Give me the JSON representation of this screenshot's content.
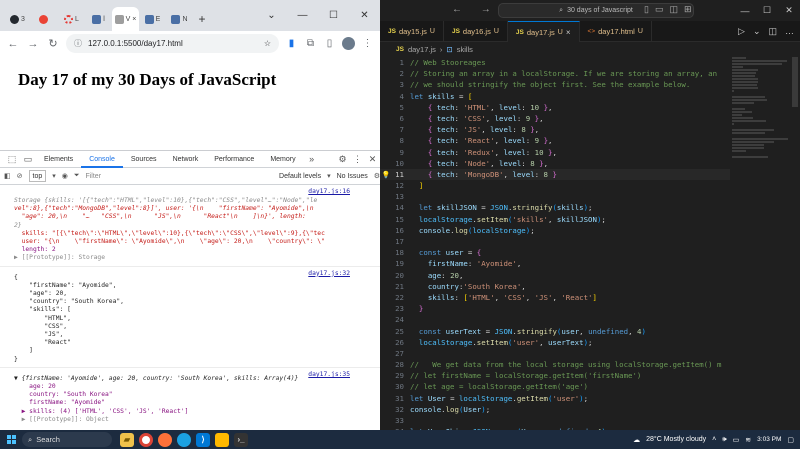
{
  "browser": {
    "tabs": [
      {
        "icon": "github-icon",
        "label": "3"
      },
      {
        "icon": "gmail-icon",
        "label": ""
      },
      {
        "icon": "tab-icon",
        "label": "L"
      },
      {
        "icon": "tab-icon",
        "label": "l"
      },
      {
        "icon": "tab-icon",
        "label": "V"
      },
      {
        "icon": "tab-icon",
        "label": "E"
      },
      {
        "icon": "tab-icon",
        "label": "N"
      }
    ],
    "url": "127.0.0.1:5500/day17.html",
    "page_heading": "Day 17 of my 30 Days of JavaScript"
  },
  "devtools": {
    "tabs": [
      "Elements",
      "Console",
      "Sources",
      "Network",
      "Performance",
      "Memory"
    ],
    "active_tab": "Console",
    "context": "top",
    "filter_placeholder": "Filter",
    "levels": "Default levels",
    "issues": "No Issues",
    "messages": [
      {
        "source": "day17.js:16",
        "lines": [
          "Storage {skills: '[{\"tech\":\"HTML\",\"level\":10},{\"tech\":\"CSS\",\"level\"…\":\"Node\",\"le",
          "vel\":8},{\"tech\":\"MongoDB\",\"level\":8}]', user: '{\\n    \"firstName\": \"Ayomide\",\\n",
          "  \"age\": 20,\\n    \"…   \"CSS\",\\n      \"JS\",\\n      \"React\"\\n    ]\\n}', length:",
          "2}",
          "  skills: \"[{\\\"tech\\\":\\\"HTML\\\",\\\"level\\\":10},{\\\"tech\\\":\\\"CSS\\\",\\\"level\\\":9},{\\\"tec",
          "  user: \"{\\n    \\\"firstName\\\": \\\"Ayomide\\\",\\n    \\\"age\\\": 20,\\n    \\\"country\\\": \\\"",
          "  length: 2",
          "▶ [[Prototype]]: Storage"
        ]
      },
      {
        "source": "day17.js:32",
        "lines": [
          "{",
          "    \"firstName\": \"Ayomide\",",
          "    \"age\": 20,",
          "    \"country\": \"South Korea\",",
          "    \"skills\": [",
          "        \"HTML\",",
          "        \"CSS\",",
          "        \"JS\",",
          "        \"React\"",
          "    ]",
          "}"
        ]
      },
      {
        "source": "day17.js:35",
        "lines": [
          "▼ {firstName: 'Ayomide', age: 20, country: 'South Korea', skills: Array(4)}",
          "    age: 20",
          "    country: \"South Korea\"",
          "    firstName: \"Ayomide\"",
          "  ▶ skills: (4) ['HTML', 'CSS', 'JS', 'React']",
          "  ▶ [[Prototype]]: Object"
        ]
      }
    ]
  },
  "vscode": {
    "search": "30 days of Javascript",
    "tabs": [
      {
        "name": "day15.js",
        "kind": "JS",
        "status": "U",
        "active": false
      },
      {
        "name": "day16.js",
        "kind": "JS",
        "status": "U",
        "active": false
      },
      {
        "name": "day17.js",
        "kind": "JS",
        "status": "U",
        "active": true
      },
      {
        "name": "day17.html",
        "kind": "<>",
        "status": "U",
        "active": false
      }
    ],
    "breadcrumb": {
      "file": "day17.js",
      "symbol": "skills"
    },
    "current_line": 11,
    "code": [
      "// Web Stooreages",
      "// Storing an array in a localStorage. If we are storing an array, an",
      "// we should stringify the object first. See the example below.",
      "let skills = [",
      "    { tech: 'HTML', level: 10 },",
      "    { tech: 'CSS', level: 9 },",
      "    { tech: 'JS', level: 8 },",
      "    { tech: 'React', level: 9 },",
      "    { tech: 'Redux', level: 10 },",
      "    { tech: 'Node', level: 8 },",
      "    { tech: 'MongoDB', level: 8 }",
      "  ]",
      "",
      "  let skillJSON = JSON.stringify(skills);",
      "  localStorage.setItem('skills', skillJSON);",
      "  console.log(localStorage);",
      "",
      "  const user = {",
      "    firstName: 'Ayomide',",
      "    age: 20,",
      "    country:'South Korea',",
      "    skills: ['HTML', 'CSS', 'JS', 'React']",
      "  }",
      "",
      "  const userText = JSON.stringify(user, undefined, 4)",
      "  localStorage.setItem('user', userText);",
      "",
      "//   We get data from the local storage using localStorage.getItem() m",
      "// let firstName = localStorage.getItem('firstName')",
      "// let age = localStorage.getItem('age')",
      "let User = localStorage.getItem('user');",
      "console.log(User);",
      "",
      "let UserObj = JSON.parse(User, undefined, 4);"
    ]
  },
  "taskbar": {
    "search_label": "Search",
    "weather": "28°C  Mostly cloudy",
    "time": "3:03 PM",
    "date": "",
    "apps": [
      "explorer",
      "chrome",
      "firefox",
      "edge",
      "vscode",
      "files",
      "terminal"
    ]
  }
}
